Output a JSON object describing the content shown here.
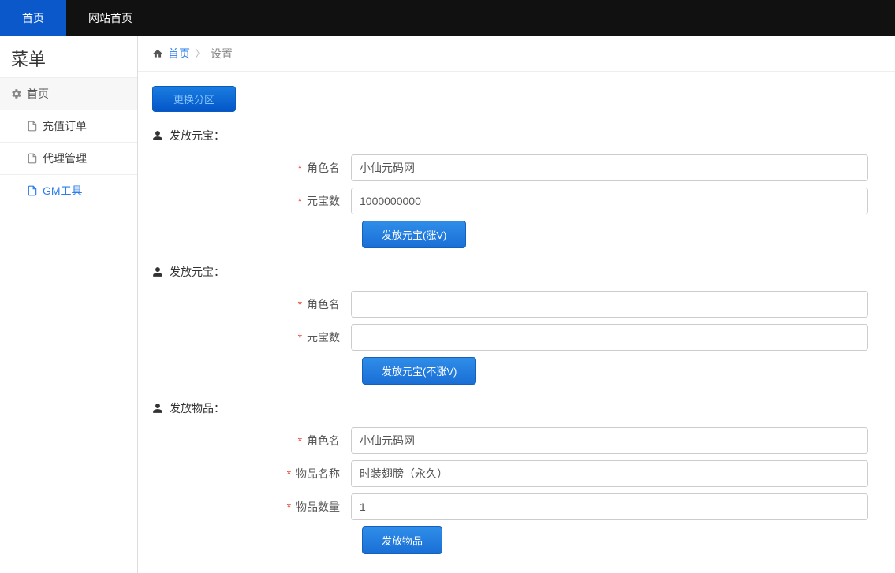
{
  "nav": {
    "tab1": "首页",
    "tab2": "网站首页"
  },
  "sidebar": {
    "title": "菜单",
    "parent": "首页",
    "items": [
      {
        "label": "充值订单"
      },
      {
        "label": "代理管理"
      },
      {
        "label": "GM工具"
      }
    ]
  },
  "breadcrumb": {
    "home": "首页",
    "current": "设置"
  },
  "region_button": "更换分区",
  "sections": {
    "s1": {
      "title": "发放元宝：",
      "role_label": "角色名",
      "role_value": "小仙元码网",
      "amount_label": "元宝数",
      "amount_value": "1000000000",
      "button": "发放元宝(涨V)"
    },
    "s2": {
      "title": "发放元宝：",
      "role_label": "角色名",
      "role_value": "",
      "amount_label": "元宝数",
      "amount_value": "",
      "button": "发放元宝(不涨V)"
    },
    "s3": {
      "title": "发放物品：",
      "role_label": "角色名",
      "role_value": "小仙元码网",
      "item_label": "物品名称",
      "item_value": "时装翅膀（永久）",
      "qty_label": "物品数量",
      "qty_value": "1",
      "button": "发放物品"
    }
  }
}
